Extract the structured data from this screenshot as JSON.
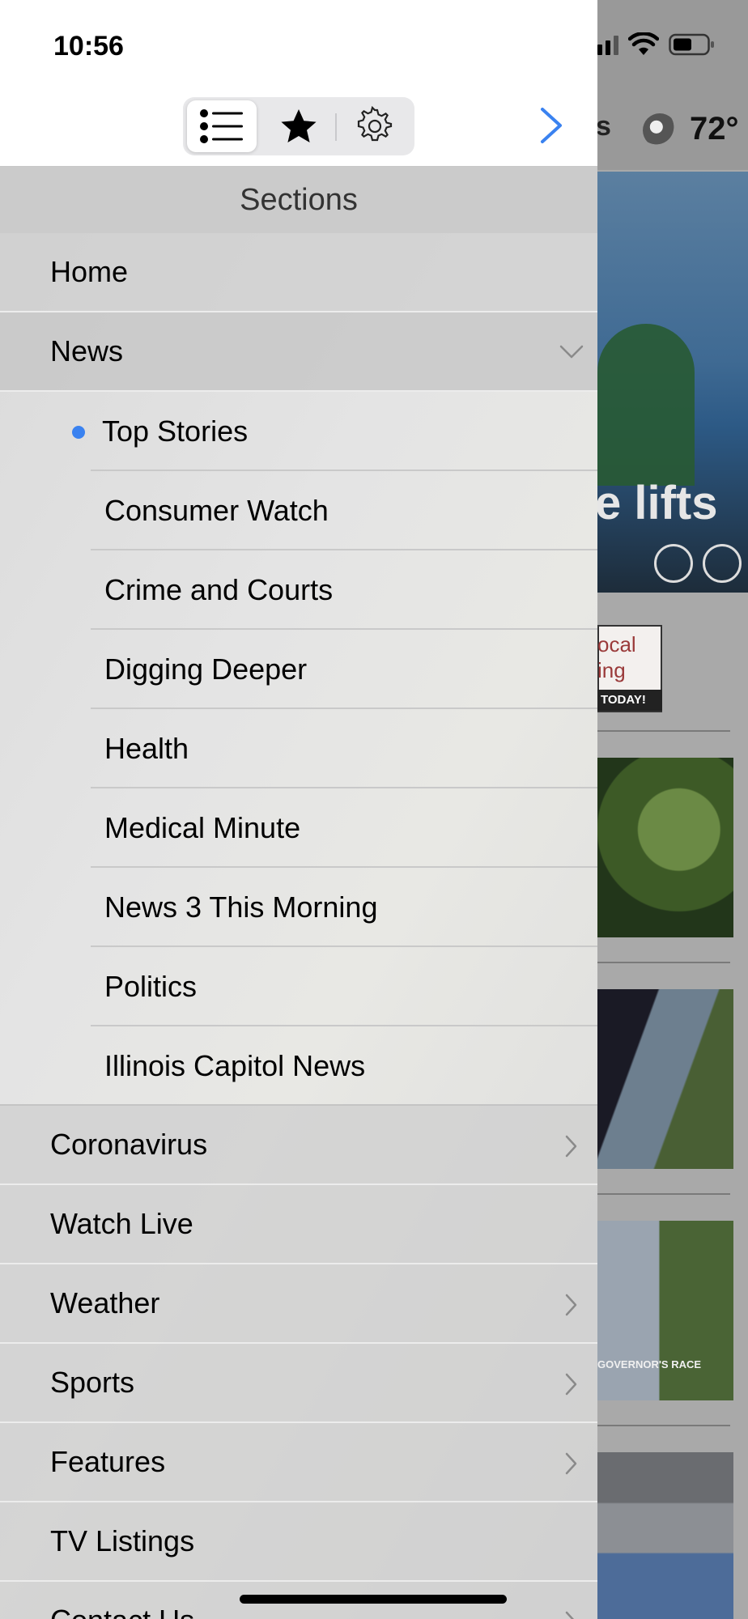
{
  "status_bar": {
    "time": "10:56"
  },
  "toolbar": {
    "segments": [
      {
        "name": "sections",
        "icon": "list-icon",
        "selected": true
      },
      {
        "name": "favorites",
        "icon": "star-icon",
        "selected": false
      },
      {
        "name": "settings",
        "icon": "gear-icon",
        "selected": false
      }
    ],
    "close_icon": "chevron-right-icon",
    "accent_color": "#3a82f0"
  },
  "sections": {
    "title": "Sections",
    "items": [
      {
        "label": "Home",
        "chevron": "none"
      },
      {
        "label": "News",
        "chevron": "down",
        "expanded": true,
        "children": [
          {
            "label": "Top Stories",
            "selected": true
          },
          {
            "label": "Consumer Watch"
          },
          {
            "label": "Crime and Courts"
          },
          {
            "label": "Digging Deeper"
          },
          {
            "label": "Health"
          },
          {
            "label": "Medical Minute"
          },
          {
            "label": "News 3 This Morning"
          },
          {
            "label": "Politics"
          },
          {
            "label": "Illinois Capitol News"
          }
        ]
      },
      {
        "label": "Coronavirus",
        "chevron": "right"
      },
      {
        "label": "Watch Live",
        "chevron": "none"
      },
      {
        "label": "Weather",
        "chevron": "right"
      },
      {
        "label": "Sports",
        "chevron": "right"
      },
      {
        "label": "Features",
        "chevron": "right"
      },
      {
        "label": "TV Listings",
        "chevron": "none"
      },
      {
        "label": "Contact Us",
        "chevron": "right"
      }
    ]
  },
  "background": {
    "tab_fragment": "s",
    "temperature": "72°",
    "headline_fragment": "e lifts",
    "ad_text_line1": "ocal",
    "ad_text_line2": "ing",
    "ad_band": "TODAY!",
    "thumb_caption": "GOVERNOR'S RACE"
  }
}
